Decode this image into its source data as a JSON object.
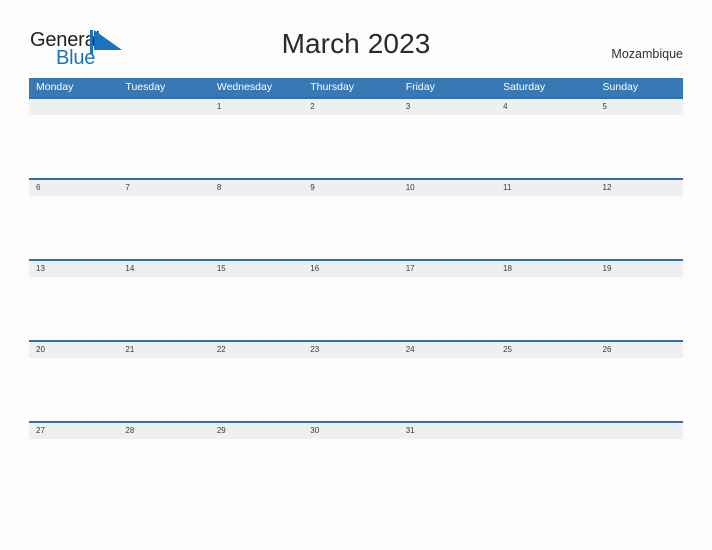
{
  "brand": {
    "name_primary": "General",
    "name_secondary": "Blue",
    "primary_color": "#231f20",
    "secondary_color": "#1b73bd",
    "flag_icon": "flag-triangle-icon"
  },
  "header": {
    "title": "March 2023",
    "month": "March",
    "year": "2023",
    "country": "Mozambique"
  },
  "colors": {
    "weekday_header_bg": "#3878b4",
    "weekday_header_text": "#ffffff",
    "week_band_bg": "#efefef",
    "week_rule": "#2f6fae",
    "page_bg": "#fcfcfd",
    "date_text": "#3a3a3a"
  },
  "calendar": {
    "weekday_headers": [
      "Monday",
      "Tuesday",
      "Wednesday",
      "Thursday",
      "Friday",
      "Saturday",
      "Sunday"
    ],
    "weeks": [
      [
        "",
        "",
        "1",
        "2",
        "3",
        "4",
        "5"
      ],
      [
        "6",
        "7",
        "8",
        "9",
        "10",
        "11",
        "12"
      ],
      [
        "13",
        "14",
        "15",
        "16",
        "17",
        "18",
        "19"
      ],
      [
        "20",
        "21",
        "22",
        "23",
        "24",
        "25",
        "26"
      ],
      [
        "27",
        "28",
        "29",
        "30",
        "31",
        "",
        ""
      ]
    ]
  }
}
